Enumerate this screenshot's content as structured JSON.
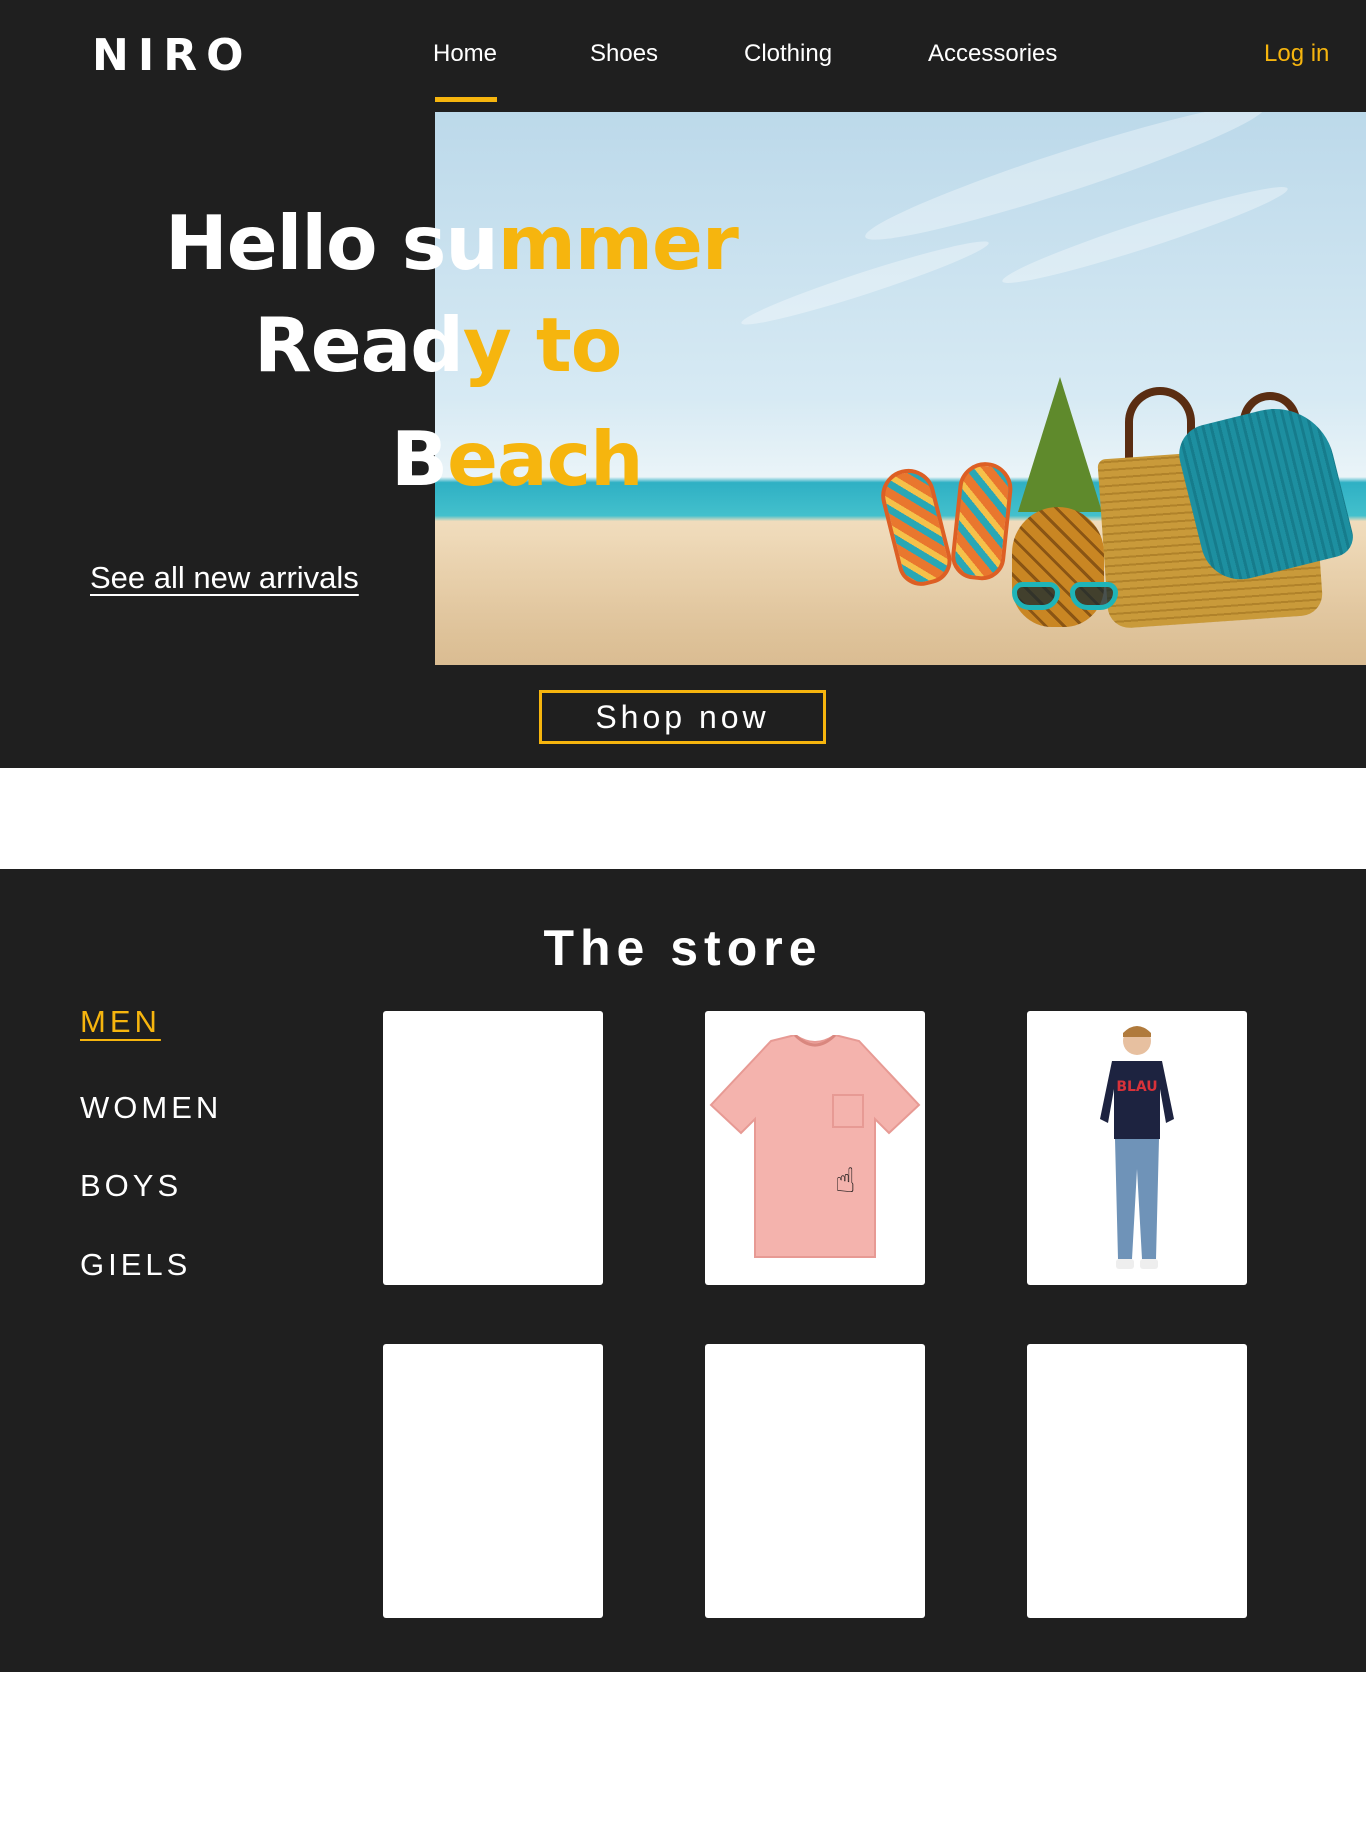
{
  "brand": {
    "name": "NIRO"
  },
  "nav": {
    "items": [
      {
        "label": "Home",
        "active": true
      },
      {
        "label": "Shoes",
        "active": false
      },
      {
        "label": "Clothing",
        "active": false
      },
      {
        "label": "Accessories",
        "active": false
      }
    ],
    "login_label": "Log in"
  },
  "hero": {
    "line1_a": "Hello su",
    "line1_b": "mmer",
    "line2_a": "Read",
    "line2_b": "y to",
    "line3_a": "B",
    "line3_b": "each",
    "link_label": "See all new arrivals",
    "cta_label": "Shop now"
  },
  "store": {
    "title": "The store",
    "categories": [
      {
        "label": "MEN",
        "active": true
      },
      {
        "label": "WOMEN",
        "active": false
      },
      {
        "label": "BOYS",
        "active": false
      },
      {
        "label": "GIELS",
        "active": false
      }
    ],
    "products": [
      {
        "image": "empty"
      },
      {
        "image": "pink-tshirt"
      },
      {
        "image": "model-blau-sweater-jeans"
      },
      {
        "image": "empty"
      },
      {
        "image": "empty"
      },
      {
        "image": "empty"
      }
    ],
    "tshirt_print": "BLAU"
  },
  "colors": {
    "accent": "#f6b50e",
    "background": "#1f1f1f",
    "text": "#ffffff",
    "tshirt": "#f4b3ad"
  }
}
